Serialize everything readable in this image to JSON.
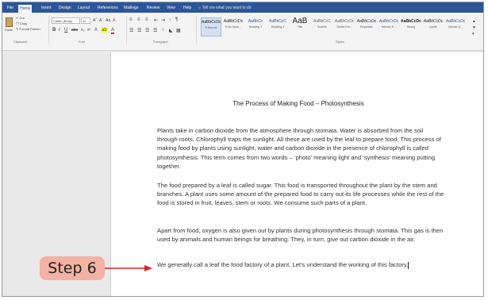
{
  "ribbon_tabs": [
    "File",
    "Home",
    "Insert",
    "Design",
    "Layout",
    "References",
    "Mailings",
    "Review",
    "View",
    "Help"
  ],
  "active_tab": "Home",
  "tell_me": "Tell me what you want to do",
  "clipboard": {
    "paste": "Paste",
    "cut": "Cut",
    "copy": "Copy",
    "format_painter": "Format Painter",
    "label": "Clipboard"
  },
  "font": {
    "family": "Calibri (Body)",
    "size": "11",
    "label": "Font"
  },
  "paragraph_label": "Paragraph",
  "styles_label": "Styles",
  "styles": [
    {
      "preview": "AaBbCcDc",
      "name": "¶ Normal"
    },
    {
      "preview": "AaBbCcDc",
      "name": "¶ No Spac..."
    },
    {
      "preview": "AaBbCc",
      "name": "Heading 1"
    },
    {
      "preview": "AaBbCcC",
      "name": "Heading 2"
    },
    {
      "preview": "AaB",
      "name": "Title"
    },
    {
      "preview": "AaBbCcC",
      "name": "Subtitle"
    },
    {
      "preview": "AaBbCcDc",
      "name": "Subtle Em..."
    },
    {
      "preview": "AaBbCcDc",
      "name": "Emphasis"
    },
    {
      "preview": "AaBbCcDc",
      "name": "Intense E..."
    },
    {
      "preview": "AaBbCcDc",
      "name": "Strong"
    },
    {
      "preview": "AaBbCcDc",
      "name": "Quote"
    },
    {
      "preview": "AaBbCcDc",
      "name": "Intense Q..."
    }
  ],
  "document": {
    "title": "The Process of Making Food – Photosynthesis",
    "paragraphs": [
      "Plants take in carbon dioxide from the atmosphere through stomata. Water is absorbed from the soil through roots. Chlorophyll traps the sunlight. All these are used by the leaf to prepare food. This process of making food by plants using sunlight, water and carbon dioxide in the presence of chlorophyll is called photosynthesis. This term comes from two words – ‘photo’ meaning light and ‘synthesis’ meaning putting together.",
      "The food prepared by a leaf is called sugar. This food is transported throughout the plant by the stem and branches. A plant uses some amount of the prepared food to carry out its life processes while the rest of the food is stored in fruit, leaves, stem or roots. We consume such parts of a plant.",
      "Apart from food, oxygen is also given out by plants during photosynthesis through stomata. This gas is then used by animals and human beings for breathing. They, in turn, give out carbon dioxide in the air.",
      "We generally call a leaf the food factory of a plant. Let’s understand the working of this factory."
    ]
  },
  "callout": {
    "label": "Step 6"
  },
  "colors": {
    "ribbon_blue": "#2b579a",
    "callout_fill": "#f3b2a3",
    "arrow": "#e0212b"
  }
}
